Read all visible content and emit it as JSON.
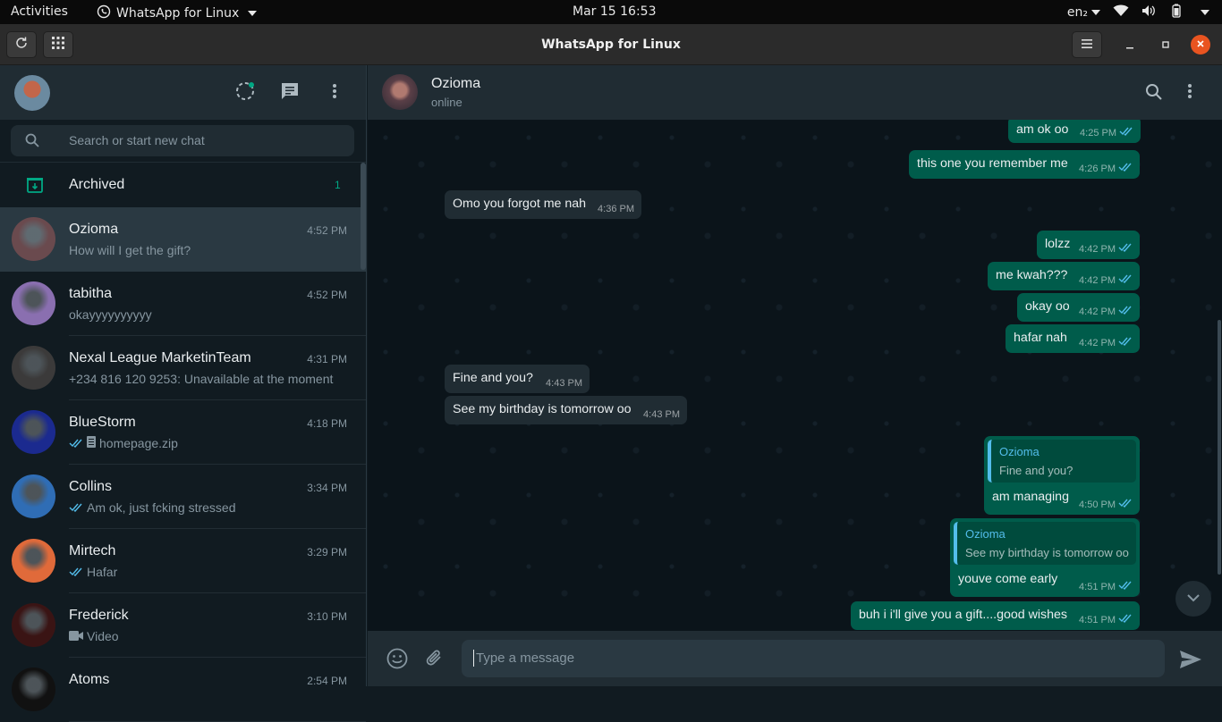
{
  "system_bar": {
    "activities": "Activities",
    "app_menu": "WhatsApp for Linux",
    "clock": "Mar 15  16:53",
    "keyboard": "en₂"
  },
  "window": {
    "title": "WhatsApp for Linux"
  },
  "sidebar": {
    "search_placeholder": "Search or start new chat",
    "archived_label": "Archived",
    "archived_count": "1",
    "chats": [
      {
        "name": "Ozioma",
        "time": "4:52 PM",
        "preview": "How will I get the gift?",
        "ticks": false,
        "icon": "",
        "avatar_color": "#6a4a4e"
      },
      {
        "name": "tabitha",
        "time": "4:52 PM",
        "preview": "okayyyyyyyyyy",
        "ticks": false,
        "icon": "",
        "avatar_color": "#8a6fb0"
      },
      {
        "name": "Nexal League MarketinTeam",
        "time": "4:31 PM",
        "preview": "+234 816 120 9253: Unavailable at the moment",
        "ticks": false,
        "icon": "",
        "avatar_color": "#3b3a3a"
      },
      {
        "name": "BlueStorm",
        "time": "4:18 PM",
        "preview": "homepage.zip",
        "ticks": true,
        "icon": "document-icon",
        "avatar_color": "#1b2a8f"
      },
      {
        "name": "Collins",
        "time": "3:34 PM",
        "preview": "Am ok, just fcking stressed",
        "ticks": true,
        "icon": "",
        "avatar_color": "#2f6db5"
      },
      {
        "name": "Mirtech",
        "time": "3:29 PM",
        "preview": "Hafar",
        "ticks": true,
        "icon": "",
        "avatar_color": "#e06a3a"
      },
      {
        "name": "Frederick",
        "time": "3:10 PM",
        "preview": "Video",
        "ticks": false,
        "icon": "video-icon",
        "avatar_color": "#3a1414"
      },
      {
        "name": "Atoms",
        "time": "2:54 PM",
        "preview": "",
        "ticks": false,
        "icon": "",
        "avatar_color": "#111111"
      }
    ]
  },
  "conversation": {
    "contact_name": "Ozioma",
    "status": "online",
    "messages": [
      {
        "dir": "out",
        "text": "am ok oo",
        "time": "4:25 PM"
      },
      {
        "dir": "out",
        "text": "this one you remember me",
        "time": "4:26 PM"
      },
      {
        "dir": "in",
        "text": "Omo you forgot me nah",
        "time": "4:36 PM"
      },
      {
        "dir": "out",
        "text": "lolzz",
        "time": "4:42 PM"
      },
      {
        "dir": "out",
        "text": "me kwah???",
        "time": "4:42 PM"
      },
      {
        "dir": "out",
        "text": "okay oo",
        "time": "4:42 PM"
      },
      {
        "dir": "out",
        "text": "hafar nah",
        "time": "4:42 PM"
      },
      {
        "dir": "in",
        "text": "Fine and you?",
        "time": "4:43 PM"
      },
      {
        "dir": "in",
        "text": "See my birthday is tomorrow oo",
        "time": "4:43 PM"
      },
      {
        "dir": "out",
        "text": "am managing",
        "time": "4:50 PM",
        "quote_name": "Ozioma",
        "quote_text": "Fine and you?"
      },
      {
        "dir": "out",
        "text": "youve come early",
        "time": "4:51 PM",
        "quote_name": "Ozioma",
        "quote_text": "See my birthday is tomorrow oo"
      },
      {
        "dir": "out",
        "text": "buh i i'll give you a gift....good wishes",
        "time": "4:51 PM"
      }
    ]
  },
  "composer": {
    "placeholder": "Type a message"
  },
  "colors": {
    "accent": "#00a884",
    "outgoing_bubble": "#005c4b",
    "incoming_bubble": "#202c33",
    "close_button": "#e95420"
  }
}
